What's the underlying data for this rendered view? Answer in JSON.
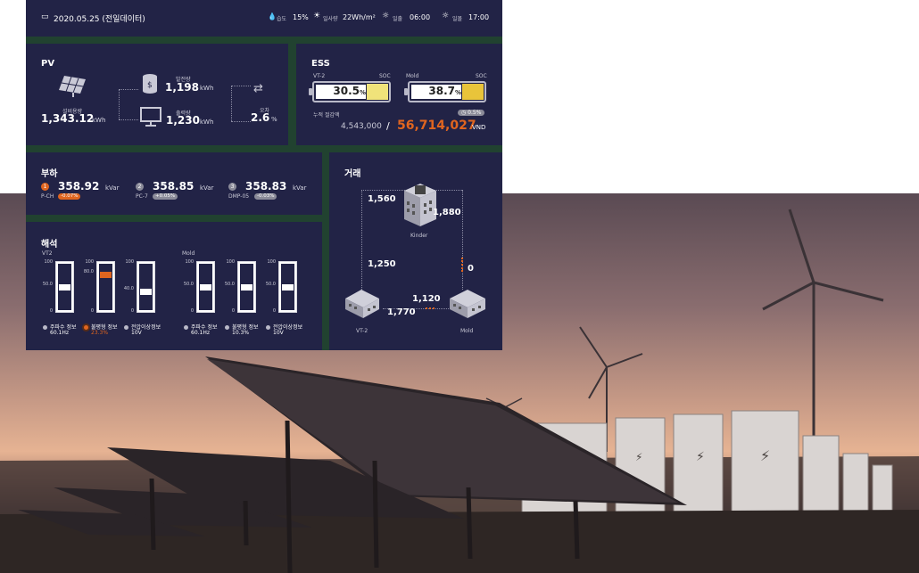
{
  "header": {
    "date": "2020.05.25 (전일데이터)",
    "humidity_label": "습도",
    "humidity_value": "15%",
    "irradiance_label": "일사량",
    "irradiance_value": "22Wh/m²",
    "sunrise_label": "일출",
    "sunrise_value": "06:00",
    "sunset_label": "일몰",
    "sunset_value": "17:00"
  },
  "pv": {
    "title": "PV",
    "generation_label": "발전량",
    "generation_value": "1,198",
    "generation_unit": "kWh",
    "output_label": "출력량",
    "output_value": "1,230",
    "output_unit": "kWh",
    "capacity_label": "설비용량",
    "capacity_value": "1,343.12",
    "capacity_unit": "kWh",
    "error_label": "오차",
    "error_value": "2.6",
    "error_unit": "%"
  },
  "ess": {
    "title": "ESS",
    "battery_1_name": "VT-2",
    "battery_1_soc_label": "SOC",
    "battery_1_value": "30.5",
    "battery_1_unit": "%",
    "battery_2_name": "Mold",
    "battery_2_soc_label": "SOC",
    "battery_2_value": "38.7",
    "battery_2_unit": "%",
    "revenue_label": "누적 절감액",
    "badge": "0.5%",
    "revenue_prev": "4,543,000",
    "separator": "/",
    "revenue_total": "56,714,027",
    "currency": "VND"
  },
  "load": {
    "title": "부하",
    "items": [
      {
        "num": "1",
        "value": "358.92",
        "unit": "kVar",
        "name": "P-CH",
        "change": "-0.07%"
      },
      {
        "num": "2",
        "value": "358.85",
        "unit": "kVar",
        "name": "PC-7",
        "change": "+0.05%"
      },
      {
        "num": "3",
        "value": "358.83",
        "unit": "kVar",
        "name": "DMP-05",
        "change": "-0.03%"
      }
    ]
  },
  "analysis": {
    "title": "해석",
    "group_1_name": "VT2",
    "group_2_name": "Mold",
    "scale_top": "100",
    "scale_mid": "50.0",
    "scale_bottom": "0",
    "gauges": [
      {
        "label": "주파수 정보",
        "value": "60.1Hz",
        "mark": "50.0",
        "level": 0.5
      },
      {
        "label": "불평형 정보",
        "value": "23.3%",
        "mark": "80.0",
        "level": 0.8
      },
      {
        "label": "전압이상정보",
        "value": "10V",
        "mark": "40.0",
        "level": 0.4
      },
      {
        "label": "주파수 정보",
        "value": "60.1Hz",
        "mark": "50.0",
        "level": 0.5
      },
      {
        "label": "불평형 정보",
        "value": "10.3%",
        "mark": "50.0",
        "level": 0.5
      },
      {
        "label": "전압이상정보",
        "value": "10V",
        "mark": "50.0",
        "level": 0.5
      }
    ]
  },
  "trade": {
    "title": "거래",
    "kinder_label": "Kinder",
    "vt2_label": "VT-2",
    "mold_label": "Mold",
    "flow_top_left": "1,560",
    "flow_top_right": "1,880",
    "flow_left": "1,250",
    "flow_right": "0",
    "flow_bottom_top": "1,120",
    "flow_bottom": "1,770"
  },
  "colors": {
    "panel": "#222346",
    "frame": "#214230",
    "accent_orange": "#e0651f",
    "battery_yellow": "#f0e37a"
  }
}
